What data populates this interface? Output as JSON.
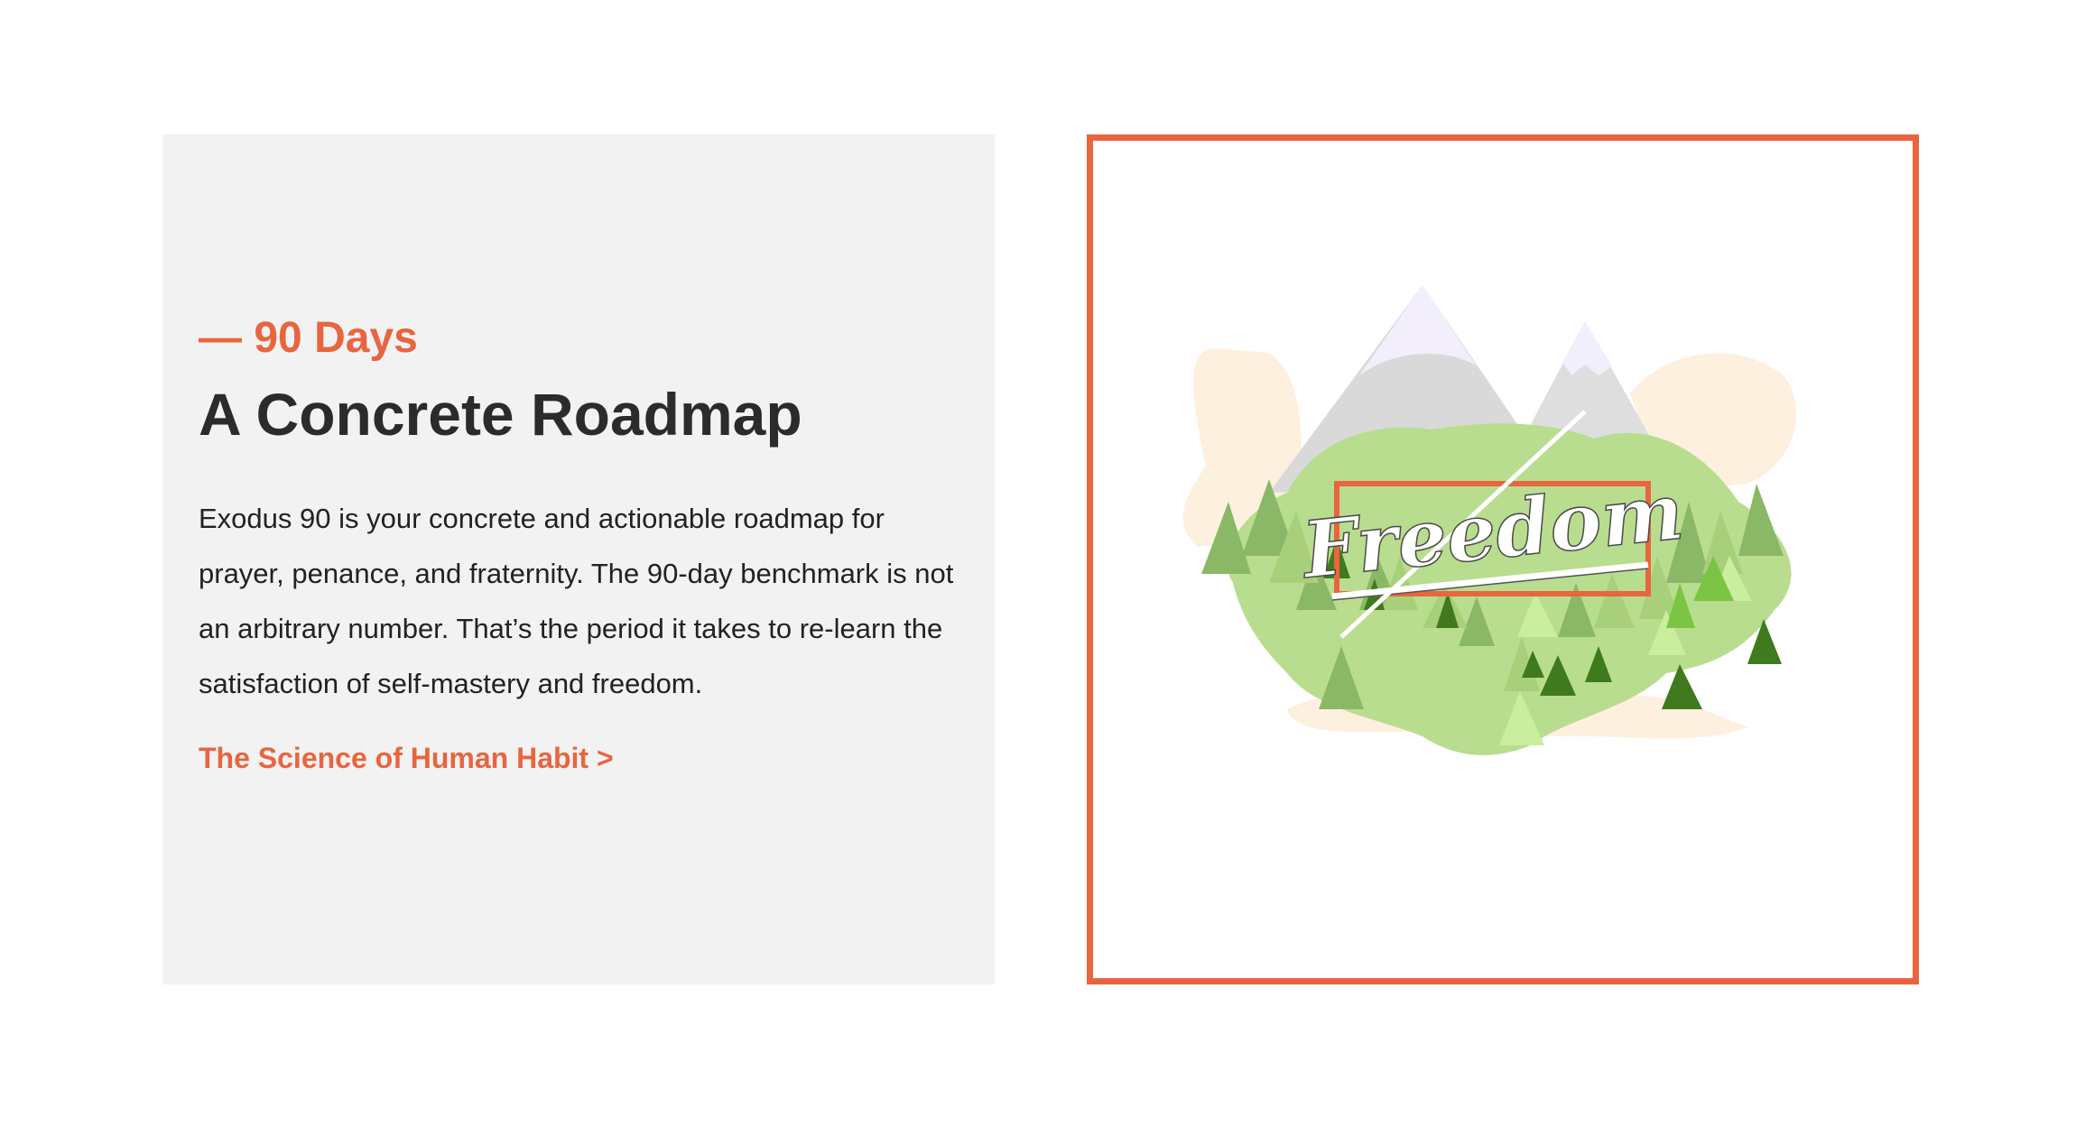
{
  "section": {
    "eyebrow": "— 90 Days",
    "headline": "A Concrete Roadmap",
    "body": "Exodus 90 is your concrete and actionable roadmap for prayer, penance, and fraternity. The 90-day benchmark is not an arbitrary number. That’s the period it takes to re-learn the satisfaction of self-mastery and freedom.",
    "link_label": "The Science of Human Habit >"
  },
  "illustration": {
    "lettering": "Freedom"
  },
  "colors": {
    "accent": "#e8653f",
    "panel_background": "#f2f2f2",
    "heading": "#2b2b2b"
  }
}
